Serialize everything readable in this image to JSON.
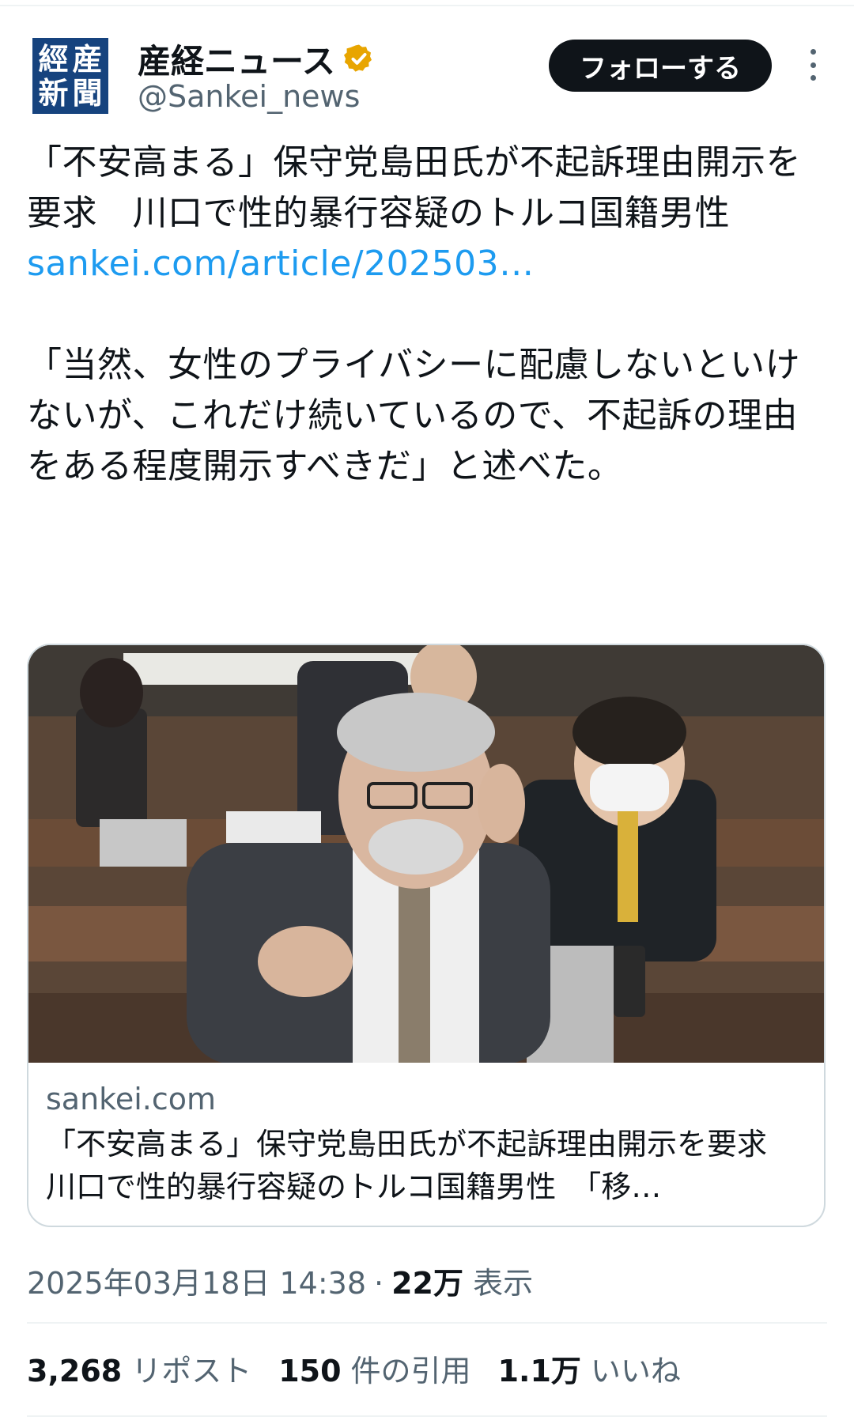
{
  "account": {
    "avatar_glyphs": [
      "産",
      "經",
      "新",
      "聞"
    ],
    "display_name": "産経ニュース",
    "handle": "@Sankei_news",
    "verified_badge": "verified-badge-icon",
    "badge_color": "#e8a500"
  },
  "actions": {
    "follow_label": "フォローする",
    "more_icon": "more-options-icon"
  },
  "tweet": {
    "headline": "「不安高まる」保守党島田氏が不起訴理由開示を要求　川口で性的暴行容疑のトルコ国籍男性",
    "link_text": "sankei.com/article/202503…",
    "quote": "「当然、女性のプライバシーに配慮しないといけないが、これだけ続いているので、不起訴の理由をある程度開示すべきだ」と述べた。"
  },
  "card": {
    "domain": "sankei.com",
    "title": "「不安高まる」保守党島田氏が不起訴理由開示を要求　川口で性的暴行容疑のトルコ国籍男性　「移…"
  },
  "meta": {
    "datetime": "2025年03月18日 14:38",
    "separator": "·",
    "views_count": "22万",
    "views_label": "表示"
  },
  "stats": {
    "reposts_count": "3,268",
    "reposts_label": "リポスト",
    "quotes_count": "150",
    "quotes_label": "件の引用",
    "likes_count": "1.1万",
    "likes_label": "いいね"
  },
  "colors": {
    "link": "#1d9bf0",
    "secondary_text": "#536471",
    "primary_text": "#0f1419",
    "avatar_bg": "#16437e"
  }
}
